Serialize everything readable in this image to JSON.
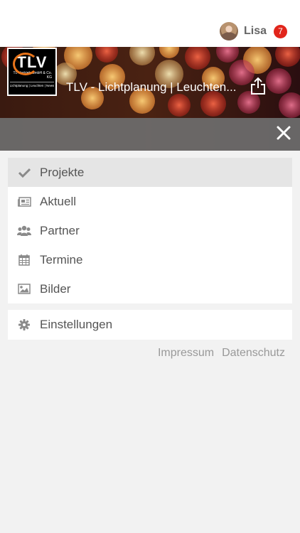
{
  "header": {
    "username": "Lisa",
    "notification_count": "7"
  },
  "hero": {
    "app_title": "TLV - Lichtplanung | Leuchten...",
    "logo": {
      "mark": "TLV",
      "company": "TL-Vertrieb GmbH & Co. KG",
      "tagline": "Lichtplanung | Leuchten | News"
    }
  },
  "menu": {
    "items": [
      {
        "label": "Projekte",
        "icon": "checkmark-icon",
        "active": true
      },
      {
        "label": "Aktuell",
        "icon": "newspaper-icon",
        "active": false
      },
      {
        "label": "Partner",
        "icon": "users-icon",
        "active": false
      },
      {
        "label": "Termine",
        "icon": "calendar-icon",
        "active": false
      },
      {
        "label": "Bilder",
        "icon": "image-icon",
        "active": false
      }
    ],
    "settings": {
      "label": "Einstellungen",
      "icon": "gear-icon"
    }
  },
  "footer": {
    "impressum": "Impressum",
    "datenschutz": "Datenschutz"
  },
  "colors": {
    "badge": "#e1251b",
    "active_item": "#e5e5e5",
    "icon": "#8a8a8a",
    "logo_accent": "#e8741a"
  }
}
